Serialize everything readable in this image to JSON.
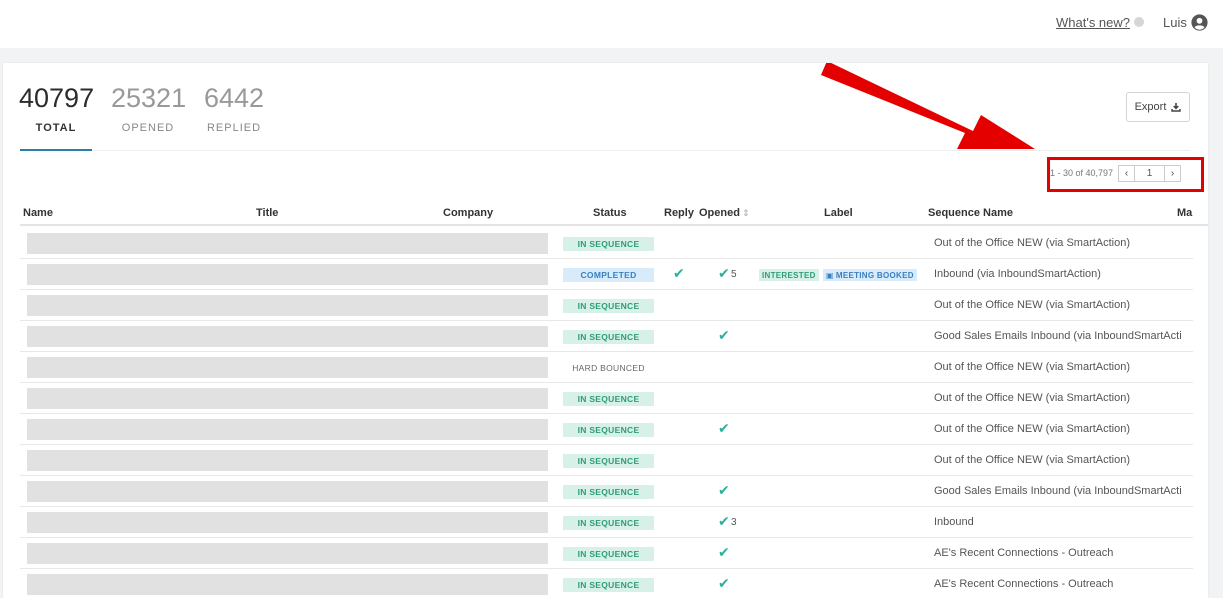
{
  "header": {
    "whats_new": "What's new?",
    "user_name": "Luis",
    "icons": [
      "status-dot-icon",
      "user-circle-icon"
    ]
  },
  "stats": {
    "total": {
      "value": "40797",
      "label": "TOTAL"
    },
    "opened": {
      "value": "25321",
      "label": "OPENED"
    },
    "replied": {
      "value": "6442",
      "label": "REPLIED"
    }
  },
  "toolbar": {
    "export_label": "Export",
    "export_icon": "download-icon"
  },
  "pagination": {
    "range_text": "1 - 30 of 40,797",
    "page": "1",
    "prev_icon": "chevron-left-icon",
    "next_icon": "chevron-right-icon"
  },
  "table": {
    "columns": [
      "Name",
      "Title",
      "Company",
      "Status",
      "Reply",
      "Opened",
      "Label",
      "Sequence Name",
      "Ma"
    ],
    "rows": [
      {
        "status": "IN SEQUENCE",
        "reply": false,
        "opened": false,
        "opened_count": "",
        "labels": [],
        "sequence": "Out of the Office NEW (via SmartAction)"
      },
      {
        "status": "COMPLETED",
        "reply": true,
        "opened": true,
        "opened_count": "5",
        "labels": [
          "INTERESTED",
          "MEETING BOOKED"
        ],
        "sequence": "Inbound (via InboundSmartAction)"
      },
      {
        "status": "IN SEQUENCE",
        "reply": false,
        "opened": false,
        "opened_count": "",
        "labels": [],
        "sequence": "Out of the Office NEW (via SmartAction)"
      },
      {
        "status": "IN SEQUENCE",
        "reply": false,
        "opened": true,
        "opened_count": "",
        "labels": [],
        "sequence": "Good Sales Emails Inbound (via InboundSmartAction)"
      },
      {
        "status": "HARD BOUNCED",
        "reply": false,
        "opened": false,
        "opened_count": "",
        "labels": [],
        "sequence": "Out of the Office NEW (via SmartAction)"
      },
      {
        "status": "IN SEQUENCE",
        "reply": false,
        "opened": false,
        "opened_count": "",
        "labels": [],
        "sequence": "Out of the Office NEW (via SmartAction)"
      },
      {
        "status": "IN SEQUENCE",
        "reply": false,
        "opened": true,
        "opened_count": "",
        "labels": [],
        "sequence": "Out of the Office NEW (via SmartAction)"
      },
      {
        "status": "IN SEQUENCE",
        "reply": false,
        "opened": false,
        "opened_count": "",
        "labels": [],
        "sequence": "Out of the Office NEW (via SmartAction)"
      },
      {
        "status": "IN SEQUENCE",
        "reply": false,
        "opened": true,
        "opened_count": "",
        "labels": [],
        "sequence": "Good Sales Emails Inbound (via InboundSmartAction)"
      },
      {
        "status": "IN SEQUENCE",
        "reply": false,
        "opened": true,
        "opened_count": "3",
        "labels": [],
        "sequence": "Inbound"
      },
      {
        "status": "IN SEQUENCE",
        "reply": false,
        "opened": true,
        "opened_count": "",
        "labels": [],
        "sequence": "AE's Recent Connections - Outreach"
      },
      {
        "status": "IN SEQUENCE",
        "reply": false,
        "opened": true,
        "opened_count": "",
        "labels": [],
        "sequence": "AE's Recent Connections - Outreach"
      }
    ]
  },
  "colors": {
    "accent": "#2a7fa8",
    "annotation_red": "#e50000",
    "check_teal": "#2bb0a0",
    "in_sequence_bg": "#d8f1e8",
    "in_sequence_fg": "#2e9c78",
    "completed_bg": "#d7ebfa",
    "completed_fg": "#3a7fc0",
    "interested_bg": "#d8f1e8",
    "interested_fg": "#2e9c78",
    "meeting_bg": "#d7ebfa",
    "meeting_fg": "#3a7fc0"
  }
}
